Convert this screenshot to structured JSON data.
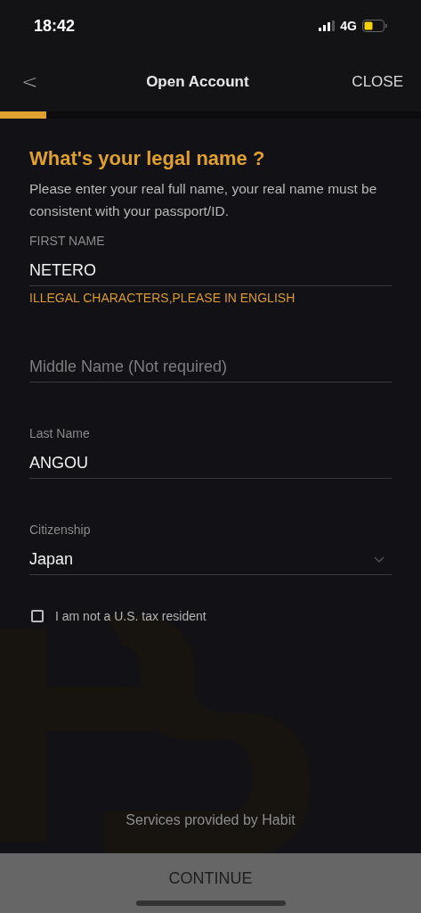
{
  "status_bar": {
    "time": "18:42",
    "network": "4G"
  },
  "nav": {
    "back": "<",
    "title": "Open Account",
    "close": "CLOSE"
  },
  "progress": {
    "level": 0.11
  },
  "heading": "What's your legal name ?",
  "description": "Please enter your real full name, your real name must be consistent with your passport/ID.",
  "fields": [
    {
      "kind": "text",
      "label": "FIRST NAME",
      "value": "NETERO",
      "error": "ILLEGAL CHARACTERS,PLEASE IN ENGLISH"
    },
    {
      "kind": "text",
      "placeholder": "Middle Name (Not required)"
    },
    {
      "kind": "text",
      "label": "Last Name",
      "value": "ANGOU"
    },
    {
      "kind": "select",
      "label": "Citizenship",
      "value": "Japan"
    }
  ],
  "tax_checkbox": {
    "label": "I am not a U.S. tax resident",
    "checked": false
  },
  "footer_note": "Services provided by Habit",
  "continue_button": "CONTINUE"
}
